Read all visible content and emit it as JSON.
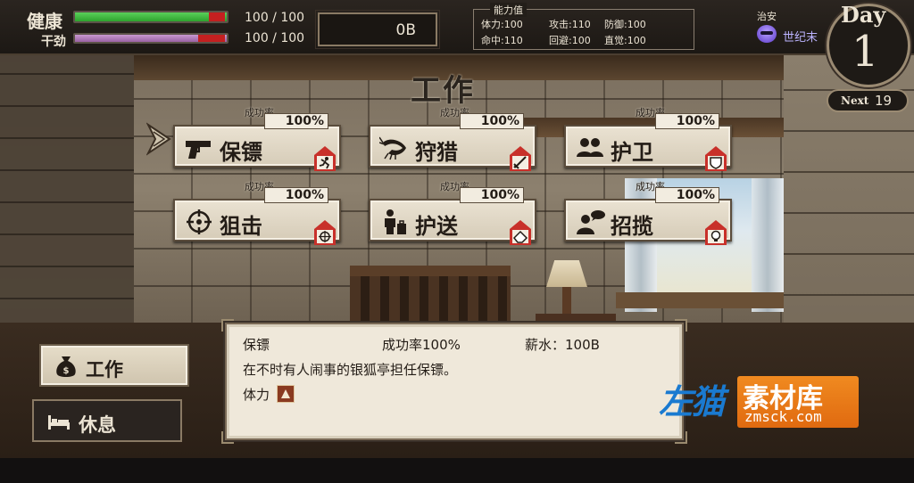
{
  "status": {
    "health_label": "健康",
    "health_value": "100 / 100",
    "health_fraction": 1.0,
    "stamina_label": "干劲",
    "stamina_value": "100 / 100",
    "stamina_fraction": 1.0
  },
  "money": "0B",
  "abilities": {
    "title": "能力值",
    "items": [
      {
        "label": "体力:",
        "value": "100"
      },
      {
        "label": "攻击:",
        "value": "110"
      },
      {
        "label": "防御:",
        "value": "100"
      },
      {
        "label": "命中:",
        "value": "110"
      },
      {
        "label": "回避:",
        "value": "100"
      },
      {
        "label": "直觉:",
        "value": "100"
      }
    ]
  },
  "security": {
    "label": "治安",
    "value": "世纪末"
  },
  "day": {
    "label": "Day",
    "number": "1",
    "next_label": "Next",
    "next_value": "19"
  },
  "page_title": "工作",
  "jobs": [
    {
      "name": "保镖",
      "rate_label": "成功率",
      "rate": "100%",
      "icon": "pistol-icon",
      "badge": "runner-badge-icon",
      "selected": true
    },
    {
      "name": "狩猎",
      "rate_label": "成功率",
      "rate": "100%",
      "icon": "shrimp-icon",
      "badge": "sword-badge-icon",
      "selected": false
    },
    {
      "name": "护卫",
      "rate_label": "成功率",
      "rate": "100%",
      "icon": "group-icon",
      "badge": "shield-badge-icon",
      "selected": false
    },
    {
      "name": "狙击",
      "rate_label": "成功率",
      "rate": "100%",
      "icon": "crosshair-icon",
      "badge": "crosshair-badge-icon",
      "selected": false
    },
    {
      "name": "护送",
      "rate_label": "成功率",
      "rate": "100%",
      "icon": "person-luggage-icon",
      "badge": "eraser-badge-icon",
      "selected": false
    },
    {
      "name": "招揽",
      "rate_label": "成功率",
      "rate": "100%",
      "icon": "person-speech-icon",
      "badge": "bulb-badge-icon",
      "selected": false
    }
  ],
  "nav": {
    "work": "工作",
    "rest": "休息"
  },
  "info": {
    "job_name": "保镖",
    "rate_text": "成功率100%",
    "salary_text": "薪水：100B",
    "description": "在不时有人闹事的银狐亭担任保镖。",
    "requirement_label": "体力"
  },
  "watermark": {
    "brand": "左猫",
    "site": "素材库",
    "url": "zmsck.com"
  },
  "colors": {
    "health": "#2ea32e",
    "stamina": "#a873b0",
    "deficit": "#c42020",
    "accent_red": "#c8302a"
  }
}
